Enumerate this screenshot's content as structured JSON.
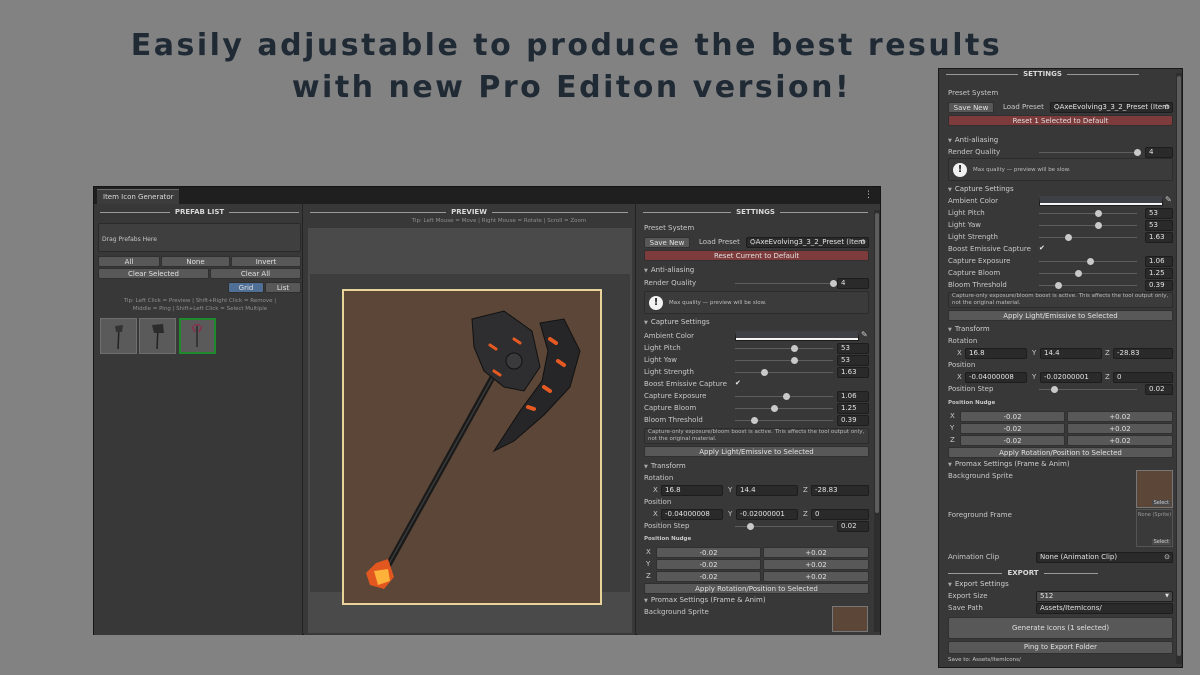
{
  "headline": {
    "line1": "Easily adjustable to produce the best results",
    "line2": "with new Pro Editon version!"
  },
  "window": {
    "tab_title": "Item Icon Generator",
    "menu_icon": "kebab-menu-icon"
  },
  "prefab_list": {
    "title": "PREFAB LIST",
    "drop_zone": "Drag Prefabs Here",
    "buttons": {
      "all": "All",
      "none": "None",
      "invert": "Invert",
      "clear_selected": "Clear Selected",
      "clear_all": "Clear All"
    },
    "view_modes": {
      "grid": "Grid",
      "list": "List",
      "active": "Grid"
    },
    "tip": "Tip: Left Click = Preview | Shift+Right Click = Remove | Middle = Ping | Shift+Left Click = Select Multiple",
    "thumbs": [
      {
        "icon": "axe-thumbnail",
        "selected": false
      },
      {
        "icon": "axe-thumbnail",
        "selected": false
      },
      {
        "icon": "axe-thumbnail",
        "selected": true
      }
    ]
  },
  "preview": {
    "title": "PREVIEW",
    "tip": "Tip: Left Mouse = Move | Right Mouse = Rotate | Scroll = Zoom",
    "frame_color": "#e8d49a",
    "bg_color": "#5b4638"
  },
  "settings": {
    "title": "SETTINGS",
    "preset_system": "Preset System",
    "save_new": "Save New",
    "load_preset": "Load Preset",
    "preset_value": "AxeEvolving3_3_2_Preset (Item",
    "reset_main": "Reset Current to Default",
    "reset_side": "Reset 1 Selected to Default",
    "aa_title": "Anti-aliasing",
    "render_quality_label": "Render Quality",
    "render_quality_value": "4",
    "render_quality_fraction": 1.0,
    "aa_help": "Max quality — preview will be slow.",
    "capture_title": "Capture Settings",
    "ambient_label": "Ambient Color",
    "light_pitch_label": "Light Pitch",
    "light_pitch_value": "53",
    "light_pitch_fraction": 0.6,
    "light_yaw_label": "Light Yaw",
    "light_yaw_value": "53",
    "light_yaw_fraction": 0.6,
    "light_strength_label": "Light Strength",
    "light_strength_value": "1.63",
    "light_strength_fraction": 0.3,
    "boost_label": "Boost Emissive Capture",
    "boost_checked": "✔",
    "exposure_label": "Capture Exposure",
    "exposure_value": "1.06",
    "exposure_fraction": 0.52,
    "bloom_label": "Capture Bloom",
    "bloom_value": "1.25",
    "bloom_fraction": 0.4,
    "threshold_label": "Bloom Threshold",
    "threshold_value": "0.39",
    "threshold_fraction": 0.19,
    "capture_help": "Capture-only exposure/bloom boost is active. This affects the tool output only, not the original material.",
    "apply_light": "Apply Light/Emissive to Selected",
    "transform_title": "Transform",
    "rotation_label": "Rotation",
    "rot_x": "16.8",
    "rot_y": "14.4",
    "rot_z": "-28.83",
    "position_label": "Position",
    "pos_x": "-0.04000008",
    "pos_y": "-0.02000001",
    "pos_z": "0",
    "position_step_label": "Position Step",
    "position_step_value": "0.02",
    "position_step_fraction": 0.15,
    "nudge_title": "Position Nudge",
    "nudge_minus": "-0.02",
    "nudge_plus": "+0.02",
    "apply_rotpos": "Apply Rotation/Position to Selected",
    "promax_title": "Promax Settings (Frame & Anim)",
    "bg_sprite_label": "Background Sprite",
    "fg_frame_label": "Foreground Frame",
    "select": "Select",
    "none_sprite": "None (Sprite)",
    "anim_clip_label": "Animation Clip",
    "anim_clip_value": "None (Animation Clip)",
    "export_title": "EXPORT",
    "export_settings": "Export Settings",
    "export_size_label": "Export Size",
    "export_size_value": "512",
    "save_path_label": "Save Path",
    "save_path_value": "Assets/ItemIcons/",
    "generate": "Generate Icons  (1 selected)",
    "ping": "Ping to Export Folder",
    "save_to": "Save to: Assets/ItemIcons/"
  },
  "axes": {
    "x": "X",
    "y": "Y",
    "z": "Z"
  },
  "colors": {
    "accent_reset": "#7d3b3b",
    "selected_tab": "#4f6f96",
    "thumb_selected": "#1f8a2c"
  }
}
